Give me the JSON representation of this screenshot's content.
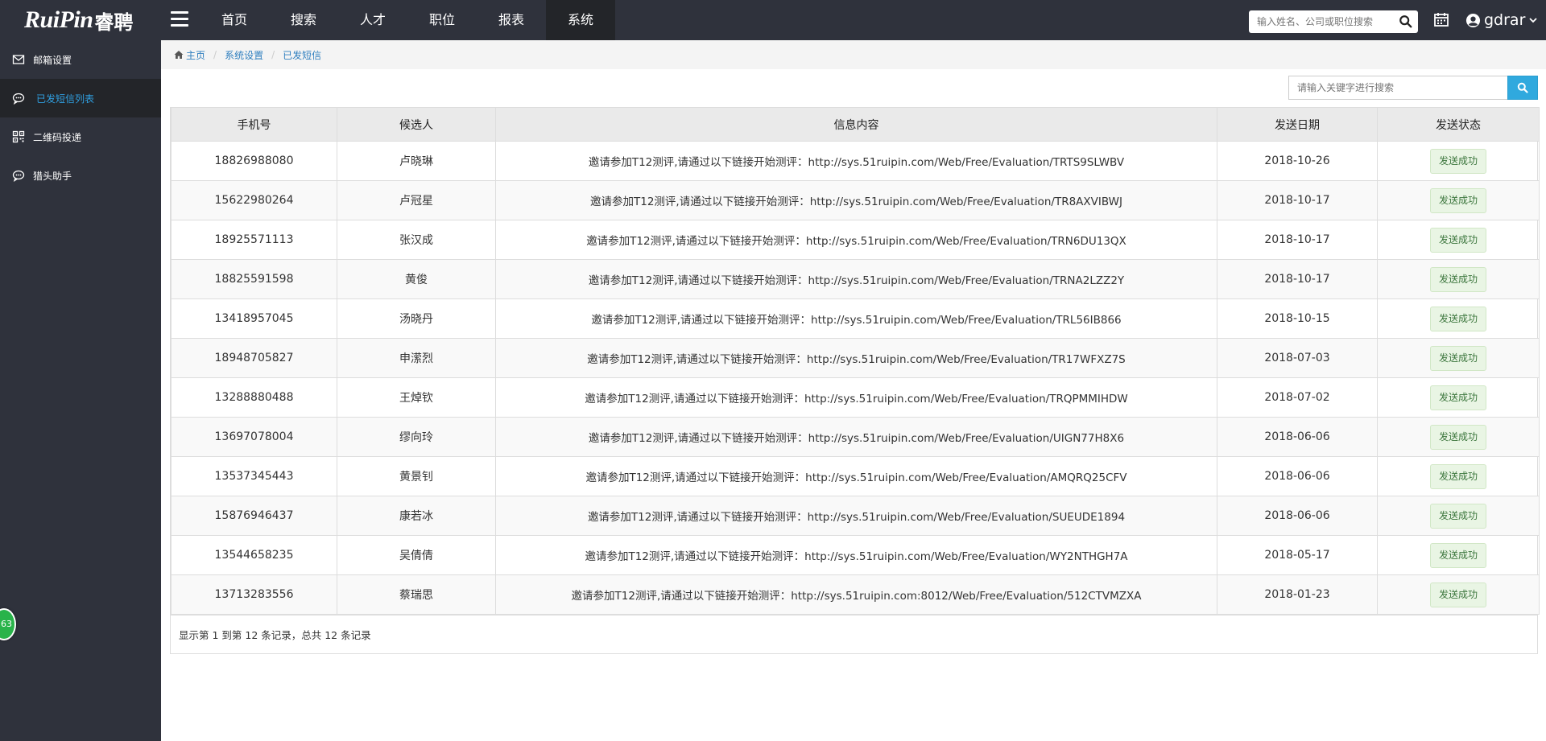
{
  "header": {
    "logo_text": "RuiPin",
    "logo_cn": "睿聘",
    "nav": [
      {
        "label": "首页"
      },
      {
        "label": "搜索"
      },
      {
        "label": "人才"
      },
      {
        "label": "职位"
      },
      {
        "label": "报表"
      },
      {
        "label": "系统"
      }
    ],
    "active_nav": "系统",
    "search_placeholder": "输入姓名、公司或职位搜索",
    "user": "gdrar"
  },
  "sidebar": {
    "items": [
      {
        "label": "邮箱设置",
        "icon": "envelope-icon"
      },
      {
        "label": "已发短信列表",
        "icon": "chat-icon"
      },
      {
        "label": "二维码投递",
        "icon": "qrcode-icon"
      },
      {
        "label": "猎头助手",
        "icon": "chat-icon"
      }
    ],
    "active_item": "已发短信列表"
  },
  "badge": "63",
  "breadcrumb": [
    "主页",
    "系统设置",
    "已发短信"
  ],
  "search": {
    "placeholder": "请输入关键字进行搜索"
  },
  "table": {
    "columns": [
      "手机号",
      "候选人",
      "信息内容",
      "发送日期",
      "发送状态"
    ],
    "rows": [
      {
        "phone": "18826988080",
        "name": "卢晓琳",
        "msg": "邀请参加T12测评,请通过以下链接开始测评：http://sys.51ruipin.com/Web/Free/Evaluation/TRTS9SLWBV",
        "date": "2018-10-26",
        "status": "发送成功"
      },
      {
        "phone": "15622980264",
        "name": "卢冠星",
        "msg": "邀请参加T12测评,请通过以下链接开始测评：http://sys.51ruipin.com/Web/Free/Evaluation/TR8AXVIBWJ",
        "date": "2018-10-17",
        "status": "发送成功"
      },
      {
        "phone": "18925571113",
        "name": "张汉成",
        "msg": "邀请参加T12测评,请通过以下链接开始测评：http://sys.51ruipin.com/Web/Free/Evaluation/TRN6DU13QX",
        "date": "2018-10-17",
        "status": "发送成功"
      },
      {
        "phone": "18825591598",
        "name": "黄俊",
        "msg": "邀请参加T12测评,请通过以下链接开始测评：http://sys.51ruipin.com/Web/Free/Evaluation/TRNA2LZZ2Y",
        "date": "2018-10-17",
        "status": "发送成功"
      },
      {
        "phone": "13418957045",
        "name": "汤晓丹",
        "msg": "邀请参加T12测评,请通过以下链接开始测评：http://sys.51ruipin.com/Web/Free/Evaluation/TRL56IB866",
        "date": "2018-10-15",
        "status": "发送成功"
      },
      {
        "phone": "18948705827",
        "name": "申潆烈",
        "msg": "邀请参加T12测评,请通过以下链接开始测评：http://sys.51ruipin.com/Web/Free/Evaluation/TR17WFXZ7S",
        "date": "2018-07-03",
        "status": "发送成功"
      },
      {
        "phone": "13288880488",
        "name": "王焯钦",
        "msg": "邀请参加T12测评,请通过以下链接开始测评：http://sys.51ruipin.com/Web/Free/Evaluation/TRQPMMIHDW",
        "date": "2018-07-02",
        "status": "发送成功"
      },
      {
        "phone": "13697078004",
        "name": "缪向玲",
        "msg": "邀请参加T12测评,请通过以下链接开始测评：http://sys.51ruipin.com/Web/Free/Evaluation/UIGN77H8X6",
        "date": "2018-06-06",
        "status": "发送成功"
      },
      {
        "phone": "13537345443",
        "name": "黄景钊",
        "msg": "邀请参加T12测评,请通过以下链接开始测评：http://sys.51ruipin.com/Web/Free/Evaluation/AMQRQ25CFV",
        "date": "2018-06-06",
        "status": "发送成功"
      },
      {
        "phone": "15876946437",
        "name": "康若冰",
        "msg": "邀请参加T12测评,请通过以下链接开始测评：http://sys.51ruipin.com/Web/Free/Evaluation/SUEUDE1894",
        "date": "2018-06-06",
        "status": "发送成功"
      },
      {
        "phone": "13544658235",
        "name": "吴倩倩",
        "msg": "邀请参加T12测评,请通过以下链接开始测评：http://sys.51ruipin.com/Web/Free/Evaluation/WY2NTHGH7A",
        "date": "2018-05-17",
        "status": "发送成功"
      },
      {
        "phone": "13713283556",
        "name": "蔡瑞思",
        "msg": "邀请参加T12测评,请通过以下链接开始测评：http://sys.51ruipin.com:8012/Web/Free/Evaluation/512CTVMZXA",
        "date": "2018-01-23",
        "status": "发送成功"
      }
    ]
  },
  "pagination_info": "显示第 1 到第 12 条记录，总共 12 条记录",
  "colors": {
    "topbar": "#2f323c",
    "active": "#232529",
    "accent": "#30a9de",
    "link": "#2f7fbf"
  }
}
